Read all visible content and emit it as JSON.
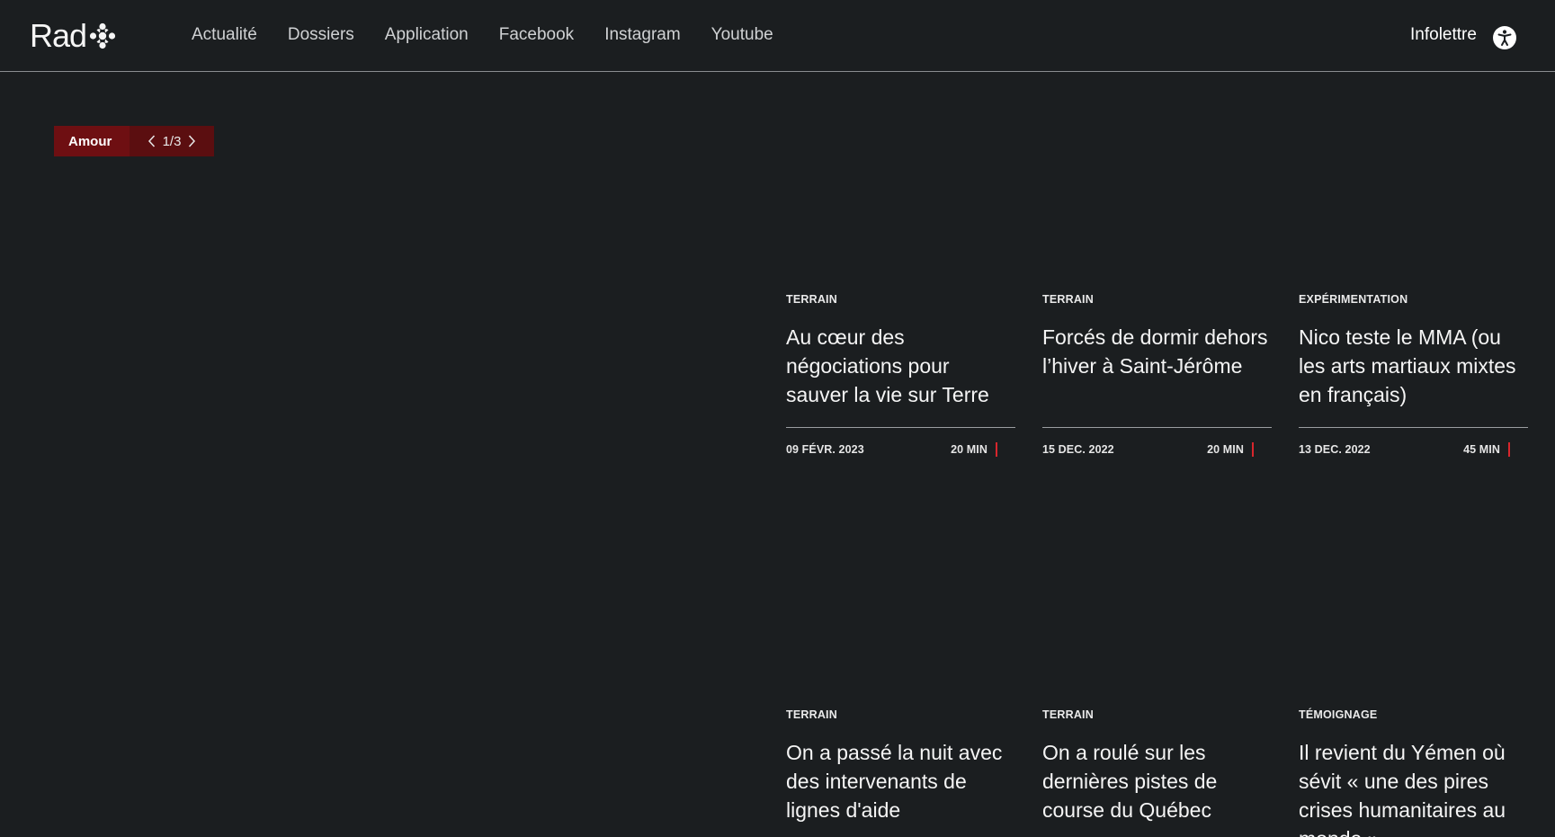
{
  "header": {
    "logo_text": "Rad",
    "nav": [
      "Actualité",
      "Dossiers",
      "Application",
      "Facebook",
      "Instagram",
      "Youtube"
    ],
    "newsletter_label": "Infolettre"
  },
  "category": {
    "label": "Amour",
    "pager": "1/3"
  },
  "cards": [
    {
      "tag": "TERRAIN",
      "title": "Au cœur des négociations pour sauver la vie sur Terre",
      "date": "09 FÉVR. 2023",
      "duration": "20 MIN"
    },
    {
      "tag": "TERRAIN",
      "title": "Forcés de dormir dehors l’hiver à Saint-Jérôme",
      "date": "15 DEC. 2022",
      "duration": "20 MIN"
    },
    {
      "tag": "EXPÉRIMENTATION",
      "title": "Nico teste le MMA (ou les arts martiaux mixtes en français)",
      "date": "13 DEC. 2022",
      "duration": "45 MIN"
    },
    {
      "tag": "TERRAIN",
      "title": "On a passé la nuit avec des intervenants de lignes d'aide"
    },
    {
      "tag": "TERRAIN",
      "title": "On a roulé sur les dernières pistes de course du Québec"
    },
    {
      "tag": "TÉMOIGNAGE",
      "title": "Il revient du Yémen où sévit « une des pires crises humanitaires au monde »"
    }
  ],
  "colors": {
    "background": "#1b1e20",
    "accent_red": "#d8262c",
    "pill_red": "#6e0f12"
  }
}
